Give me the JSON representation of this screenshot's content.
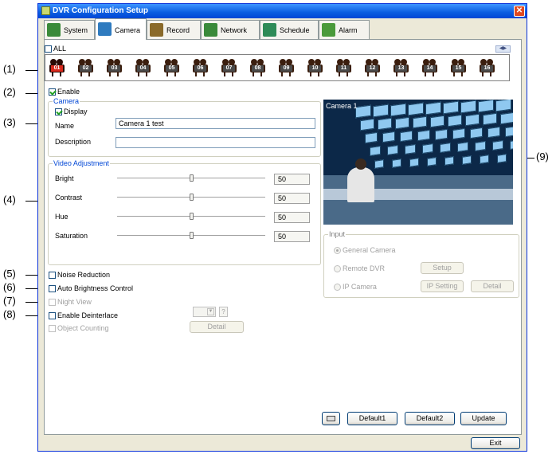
{
  "window": {
    "title": "DVR Configuration Setup",
    "close_glyph": "✕"
  },
  "tabs": [
    {
      "label": "System",
      "icon": "system-icon",
      "color": "#3a8a3a"
    },
    {
      "label": "Camera",
      "icon": "camera-tab-icon",
      "color": "#2f7bbf"
    },
    {
      "label": "Record",
      "icon": "record-icon",
      "color": "#8a6a2a"
    },
    {
      "label": "Network",
      "icon": "network-icon",
      "color": "#3a8a3a"
    },
    {
      "label": "Schedule",
      "icon": "schedule-icon",
      "color": "#2e8b57"
    },
    {
      "label": "Alarm",
      "icon": "alarm-icon",
      "color": "#4a9a3a"
    }
  ],
  "active_tab": "Camera",
  "all_label": "ALL",
  "cameras": [
    "01",
    "02",
    "03",
    "04",
    "05",
    "06",
    "07",
    "08",
    "09",
    "10",
    "11",
    "12",
    "13",
    "14",
    "15",
    "16"
  ],
  "selected_camera": "01",
  "callouts": [
    "(1)",
    "(2)",
    "(3)",
    "(4)",
    "(5)",
    "(6)",
    "(7)",
    "(8)",
    "(9)"
  ],
  "enable": {
    "label": "Enable",
    "checked": true
  },
  "camera_group": {
    "title": "Camera",
    "display_label": "Display",
    "name_label": "Name",
    "name_value": "Camera 1 test",
    "description_label": "Description",
    "description_value": ""
  },
  "video_adjustment": {
    "title": "Video Adjustment",
    "items": [
      {
        "label": "Bright",
        "value": "50"
      },
      {
        "label": "Contrast",
        "value": "50"
      },
      {
        "label": "Hue",
        "value": "50"
      },
      {
        "label": "Saturation",
        "value": "50"
      }
    ]
  },
  "options": {
    "noise_reduction": "Noise Reduction",
    "auto_brightness": "Auto Brightness Control",
    "night_view": "Night View",
    "enable_deinterlace": "Enable Deinterlace",
    "object_counting": "Object Counting",
    "deinterlace_help": "?",
    "detail_label": "Detail"
  },
  "preview": {
    "overlay_text": "Camera 1"
  },
  "input": {
    "title": "Input",
    "general_camera": "General Camera",
    "remote_dvr": "Remote DVR",
    "ip_camera": "IP Camera",
    "setup_label": "Setup",
    "ip_setting_label": "IP Setting",
    "detail_label": "Detail"
  },
  "buttons": {
    "default1": "Default1",
    "default2": "Default2",
    "update": "Update",
    "exit": "Exit"
  },
  "colors": {
    "titlebar": "#0a5ce0",
    "selected_camera": "#d8281c",
    "group_title": "#0046d5"
  }
}
